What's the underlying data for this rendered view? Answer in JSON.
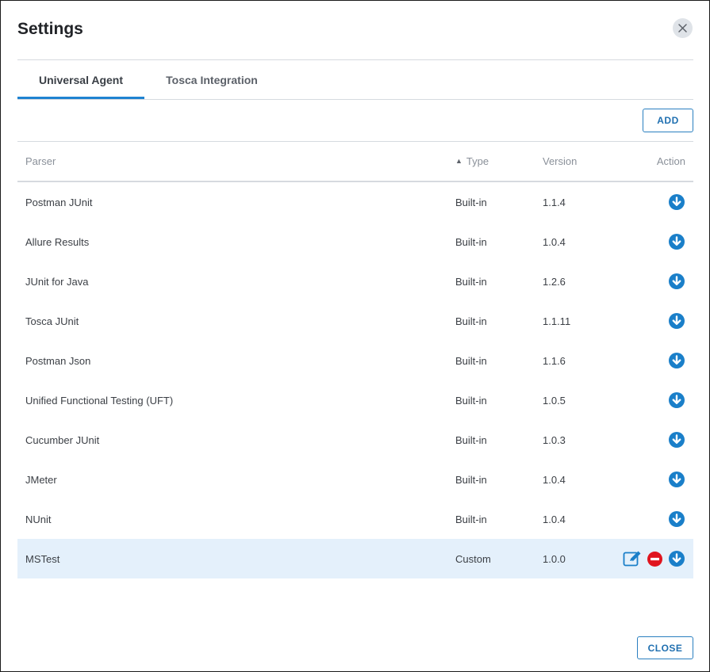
{
  "dialog": {
    "title": "Settings",
    "close_label": "CLOSE"
  },
  "tabs": [
    {
      "label": "Universal Agent",
      "active": true
    },
    {
      "label": "Tosca Integration",
      "active": false
    }
  ],
  "toolbar": {
    "add_label": "ADD"
  },
  "table": {
    "columns": {
      "parser": "Parser",
      "type": "Type",
      "version": "Version",
      "action": "Action"
    },
    "sort": {
      "column": "type",
      "direction": "ascending"
    },
    "rows": [
      {
        "parser": "Postman JUnit",
        "type": "Built-in",
        "version": "1.1.4",
        "actions": [
          "download"
        ]
      },
      {
        "parser": "Allure Results",
        "type": "Built-in",
        "version": "1.0.4",
        "actions": [
          "download"
        ]
      },
      {
        "parser": "JUnit for Java",
        "type": "Built-in",
        "version": "1.2.6",
        "actions": [
          "download"
        ]
      },
      {
        "parser": "Tosca JUnit",
        "type": "Built-in",
        "version": "1.1.11",
        "actions": [
          "download"
        ]
      },
      {
        "parser": "Postman Json",
        "type": "Built-in",
        "version": "1.1.6",
        "actions": [
          "download"
        ]
      },
      {
        "parser": "Unified Functional Testing (UFT)",
        "type": "Built-in",
        "version": "1.0.5",
        "actions": [
          "download"
        ]
      },
      {
        "parser": "Cucumber JUnit",
        "type": "Built-in",
        "version": "1.0.3",
        "actions": [
          "download"
        ]
      },
      {
        "parser": "JMeter",
        "type": "Built-in",
        "version": "1.0.4",
        "actions": [
          "download"
        ]
      },
      {
        "parser": "NUnit",
        "type": "Built-in",
        "version": "1.0.4",
        "actions": [
          "download"
        ]
      },
      {
        "parser": "MSTest",
        "type": "Custom",
        "version": "1.0.0",
        "actions": [
          "edit",
          "delete",
          "download"
        ],
        "selected": true
      }
    ]
  },
  "icons": {
    "close": "close-icon",
    "sort": "sort-up-icon",
    "download": "download-circle-icon",
    "edit": "edit-icon",
    "delete": "delete-icon"
  },
  "colors": {
    "accent": "#1f83d1",
    "download_icon": "#1a7fc9",
    "delete_icon": "#e0141e",
    "selected_row": "#e4f0fb"
  }
}
